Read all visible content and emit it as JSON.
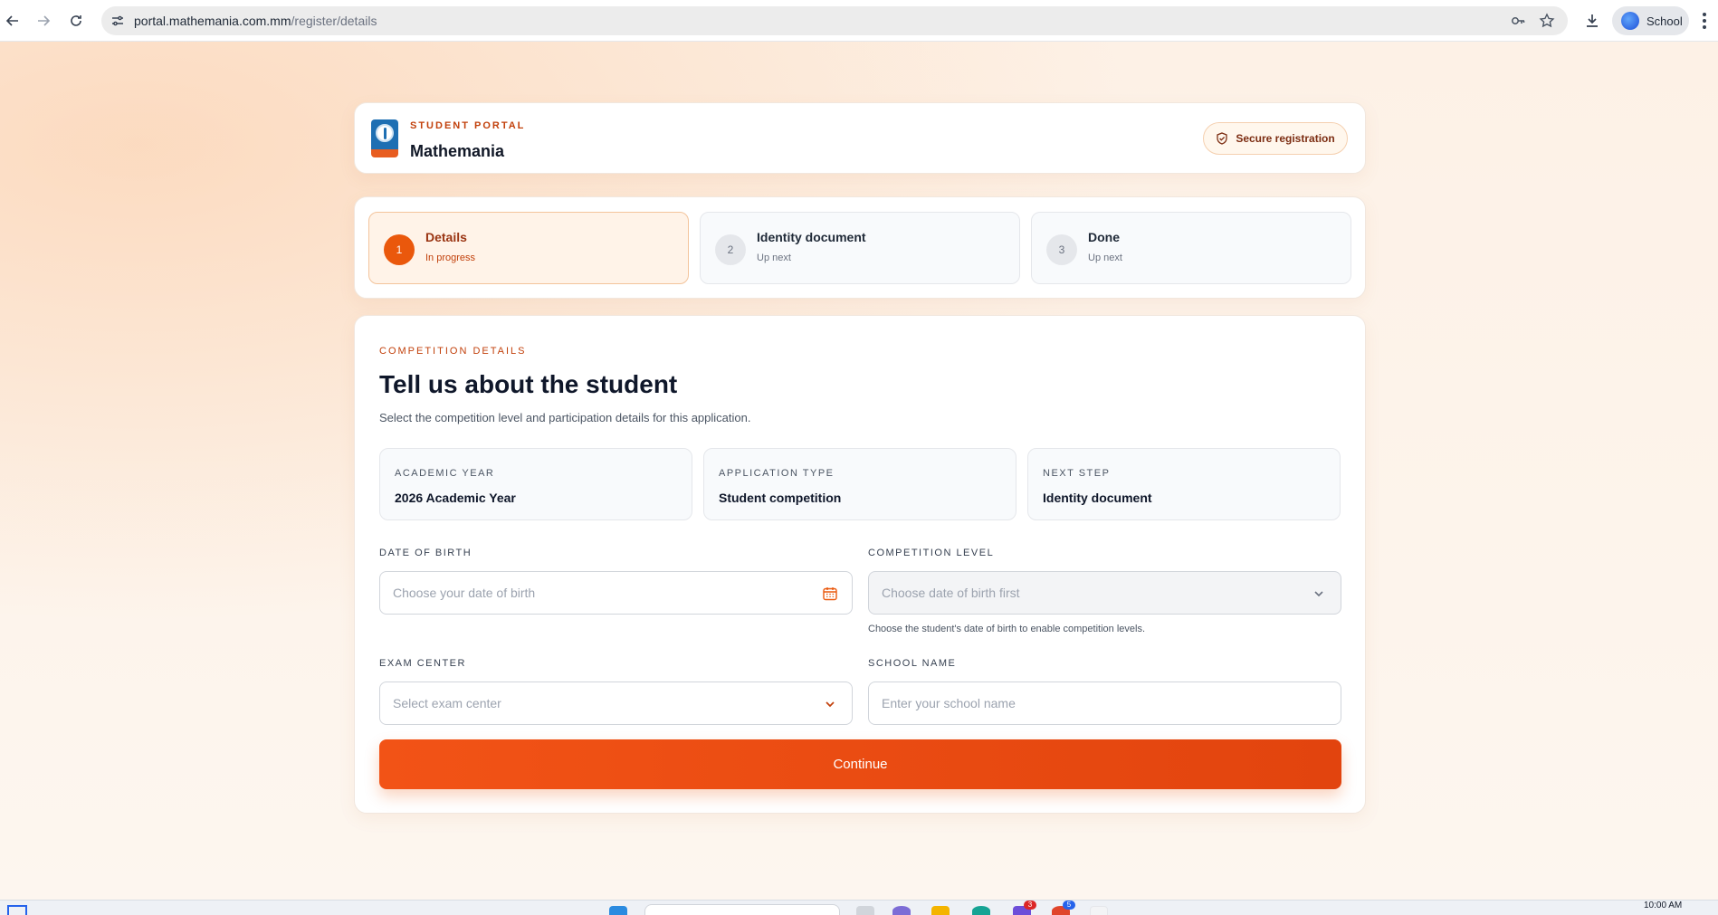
{
  "browser": {
    "url_host": "portal.mathemania.com.mm",
    "url_path": "/register/details",
    "profile_name": "School"
  },
  "header": {
    "eyebrow": "STUDENT PORTAL",
    "title": "Mathemania",
    "secure_badge": "Secure registration"
  },
  "stepper": {
    "steps": [
      {
        "number": "1",
        "label": "Details",
        "status": "In progress",
        "active": true
      },
      {
        "number": "2",
        "label": "Identity document",
        "status": "Up next",
        "active": false
      },
      {
        "number": "3",
        "label": "Done",
        "status": "Up next",
        "active": false
      }
    ]
  },
  "form": {
    "eyebrow": "COMPETITION DETAILS",
    "title": "Tell us about the student",
    "description": "Select the competition level and participation details for this application.",
    "info_tiles": [
      {
        "label": "ACADEMIC YEAR",
        "value": "2026 Academic Year"
      },
      {
        "label": "APPLICATION TYPE",
        "value": "Student competition"
      },
      {
        "label": "NEXT STEP",
        "value": "Identity document"
      }
    ],
    "fields": {
      "date_of_birth": {
        "label": "DATE OF BIRTH",
        "placeholder": "Choose your date of birth",
        "icon": "calendar-icon"
      },
      "competition_level": {
        "label": "COMPETITION LEVEL",
        "placeholder": "Choose date of birth first",
        "help": "Choose the student's date of birth to enable competition levels.",
        "disabled": true
      },
      "exam_center": {
        "label": "EXAM CENTER",
        "placeholder": "Select exam center"
      },
      "school_name": {
        "label": "SCHOOL NAME",
        "placeholder": "Enter your school name"
      }
    },
    "continue_label": "Continue"
  },
  "taskbar": {
    "time": "10:00 AM",
    "badges": [
      "3",
      "5"
    ]
  },
  "colors": {
    "accent": "#ea580c",
    "accent_dark": "#c2410c",
    "background": "#fdf3ea"
  }
}
